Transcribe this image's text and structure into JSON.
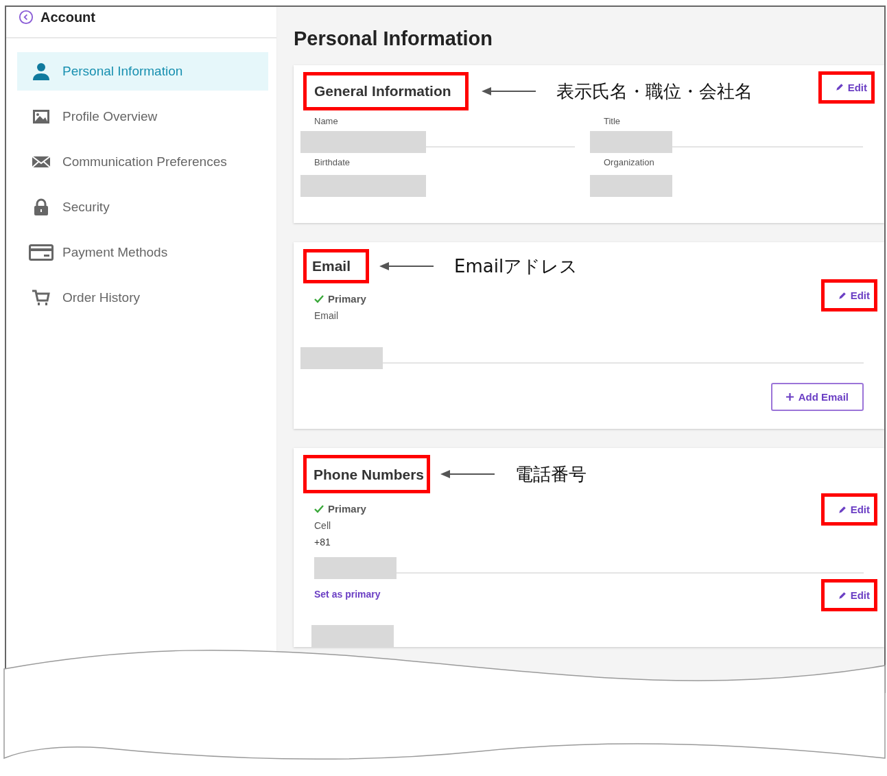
{
  "sidebar": {
    "back_label": "Account",
    "items": [
      {
        "label": "Personal Information",
        "selected": true
      },
      {
        "label": "Profile Overview",
        "selected": false
      },
      {
        "label": "Communication Preferences",
        "selected": false
      },
      {
        "label": "Security",
        "selected": false
      },
      {
        "label": "Payment Methods",
        "selected": false
      },
      {
        "label": "Order History",
        "selected": false
      }
    ]
  },
  "page_title": "Personal Information",
  "sections": [
    {
      "kind": "general",
      "heading": "General Information",
      "annotation": "表示氏名・職位・会社名",
      "edit": "Edit",
      "fields": [
        {
          "label": "Name"
        },
        {
          "label": "Title"
        },
        {
          "label": "Birthdate"
        },
        {
          "label": "Organization"
        }
      ]
    },
    {
      "kind": "email",
      "heading": "Email",
      "annotation": "Emailアドレス",
      "edit": "Edit",
      "primary": "Primary",
      "field_label": "Email",
      "add_button": "Add Email"
    },
    {
      "kind": "phone",
      "heading": "Phone Numbers",
      "annotation": "電話番号",
      "entries": [
        {
          "primary": "Primary",
          "type": "Cell",
          "code": "+81",
          "edit": "Edit"
        },
        {
          "link": "Set as primary",
          "edit": "Edit"
        }
      ]
    }
  ]
}
